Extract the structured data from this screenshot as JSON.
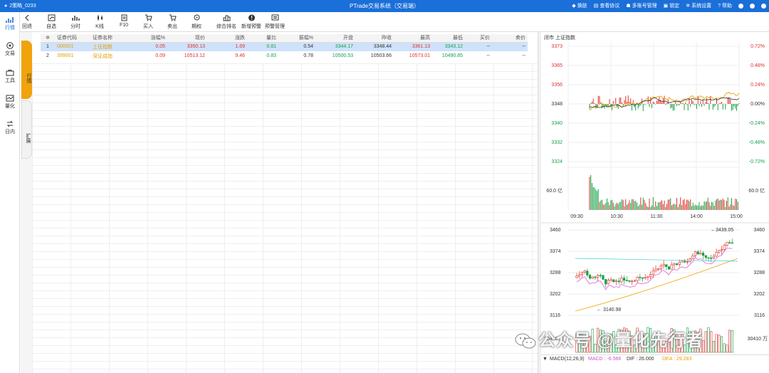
{
  "titlebar": {
    "user": "2策略_0233",
    "title": "PTrade交易系统（交易端）",
    "right_items": [
      "换肤",
      "查看协议",
      "多账号管理",
      "锁定",
      "系统设置",
      "帮助"
    ]
  },
  "toolbar": {
    "items": [
      "回退",
      "自选",
      "分时",
      "K线",
      "F10",
      "买入",
      "卖出",
      "期权",
      "综合排名",
      "新增预警",
      "预警管理"
    ]
  },
  "leftnav": {
    "items": [
      "行情",
      "交易",
      "工具",
      "量化",
      "日内"
    ]
  },
  "sidetabs": {
    "active": "行情",
    "inactive": "扩展"
  },
  "table": {
    "headers": [
      "",
      "证券代码",
      "证券名称",
      "涨幅%",
      "现价",
      "涨跌",
      "量比",
      "振幅%",
      "开盘",
      "昨收",
      "最高",
      "最低",
      "买价",
      "卖价"
    ],
    "rows": [
      {
        "idx": "1",
        "code": "000001",
        "name": "上证指数",
        "pct": "0.05",
        "price": "3350.13",
        "chg": "1.69",
        "vr": "0.81",
        "amp": "0.54",
        "open": "3344.17",
        "prev": "3348.44",
        "high": "3361.13",
        "low": "3343.12",
        "bid": "--",
        "ask": "--"
      },
      {
        "idx": "2",
        "code": "399001",
        "name": "深证成指",
        "pct": "0.09",
        "price": "10513.12",
        "chg": "9.46",
        "vr": "0.83",
        "amp": "0.78",
        "open": "10500.53",
        "prev": "10503.66",
        "high": "10573.01",
        "low": "10490.85",
        "bid": "--",
        "ask": "--"
      }
    ]
  },
  "right_panel": {
    "header": "闭市  上证指数",
    "price_axis": [
      "3373",
      "3365",
      "3356",
      "3348",
      "3340",
      "3332",
      "3324"
    ],
    "pct_axis": [
      "0.72%",
      "0.48%",
      "0.24%",
      "0.00%",
      "-0.24%",
      "-0.48%",
      "-0.72%"
    ],
    "volume_label": "60.0 亿",
    "time_axis": [
      "09:30",
      "10:30",
      "11:30",
      "14:00",
      "15:00"
    ],
    "kline_axis": [
      "3460",
      "3374",
      "3288",
      "3202",
      "3116"
    ],
    "kline_high": "3439.05",
    "kline_low": "3140.98",
    "kvol_left": "30410.万",
    "kvol_right": "30410 万",
    "macd_label": "MACD(12,26,9)",
    "macd_value": "MACD : -6.566",
    "dif_value": "DIF : 26.000",
    "dea_value": "DEA : 29.283"
  },
  "watermark": {
    "text": "公众号 @量化先行者"
  },
  "colors": {
    "titlebar": "#1a6fd8",
    "up": "#e0302a",
    "down": "#17a046",
    "accent": "#f0a30a"
  }
}
